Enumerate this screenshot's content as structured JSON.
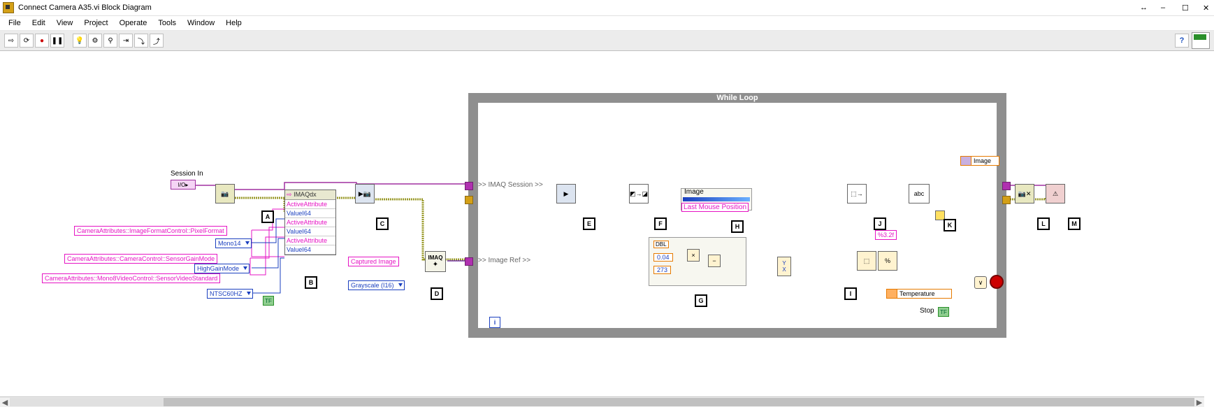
{
  "window": {
    "title": "Connect Camera A35.vi Block Diagram",
    "minimize": "–",
    "maximize": "☐",
    "close": "✕",
    "resize": "↔"
  },
  "menu": {
    "file": "File",
    "edit": "Edit",
    "view": "View",
    "project": "Project",
    "operate": "Operate",
    "tools": "Tools",
    "window": "Window",
    "help": "Help"
  },
  "toolbar": {
    "run": "⇨",
    "runcont": "⟳",
    "abort": "●",
    "pause": "❚❚",
    "hilite": "💡",
    "retain": "⚙",
    "probe": "⚲",
    "step1": "⇥",
    "step2": "⤵",
    "step3": "⤴",
    "help": "?"
  },
  "labels": {
    "session_in": "Session In",
    "captured_image": "Captured Image",
    "grayscale": "Grayscale (I16)",
    "mono14": "Mono14",
    "highgain": "HighGainMode",
    "ntsc": "NTSC60HZ",
    "attr_pixelformat": "CameraAttributes::ImageFormatControl::PixelFormat",
    "attr_gainmode": "CameraAttributes::CameraControl::SensorGainMode",
    "attr_videostd": "CameraAttributes::Mono8VideoControl::SensorVideoStandard",
    "imaq_session": ">> IMAQ Session >>",
    "image_ref": ">> Image Ref >>",
    "while_loop": "While Loop",
    "image": "Image",
    "last_mouse": "Last Mouse Position",
    "temperature": "Temperature",
    "stop": "Stop",
    "fmt": "%3.2f",
    "const004": "0.04",
    "const273": "273",
    "dbl": "DBL",
    "x": "X",
    "y": "Y",
    "imaqdx": "IMAQdx",
    "activeattr": "ActiveAttribute",
    "vali64": "ValueI64",
    "imaq_txt": "IMAQ",
    "io": "I/O",
    "tf": "TF",
    "arrow": "▸",
    "abc": "abc"
  },
  "letters": {
    "A": "A",
    "B": "B",
    "C": "C",
    "D": "D",
    "E": "E",
    "F": "F",
    "G": "G",
    "H": "H",
    "I": "I",
    "J": "J",
    "K": "K",
    "L": "L",
    "M": "M"
  }
}
